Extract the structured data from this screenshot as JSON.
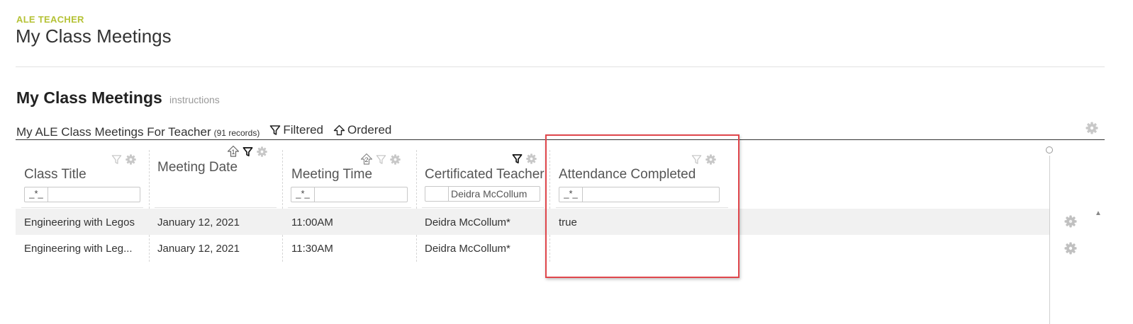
{
  "app": {
    "eyebrow": "ALE TEACHER",
    "title": "My Class Meetings"
  },
  "section": {
    "title": "My Class Meetings",
    "instructions_link": "instructions"
  },
  "view": {
    "name": "My ALE Class Meetings For Teacher",
    "record_count": "(91 records)",
    "filtered_label": "Filtered",
    "ordered_label": "Ordered"
  },
  "columns": [
    {
      "header": "Class Title",
      "filter_tag": "_*_",
      "filter_value": "",
      "sort_order": ""
    },
    {
      "header": "Meeting Date",
      "filter_tag": "",
      "filter_value": "",
      "sort_order": "1"
    },
    {
      "header": "Meeting Time",
      "filter_tag": "_*_",
      "filter_value": "",
      "sort_order": "2"
    },
    {
      "header": "Certificated Teacher",
      "filter_tag": "",
      "filter_value": "Deidra McCollum",
      "sort_order": ""
    },
    {
      "header": "Attendance Completed",
      "filter_tag": "_*_",
      "filter_value": "",
      "sort_order": ""
    }
  ],
  "rows": [
    {
      "class_title": "Engineering with Legos",
      "meeting_date": "January 12, 2021",
      "meeting_time": "11:00AM",
      "teacher": "Deidra McCollum*",
      "attendance_completed": "true"
    },
    {
      "class_title": "Engineering with Leg...",
      "meeting_date": "January 12, 2021",
      "meeting_time": "11:30AM",
      "teacher": "Deidra McCollum*",
      "attendance_completed": ""
    }
  ],
  "scroll_up_glyph": "▲",
  "icons": {
    "gear": "gear-icon",
    "filter": "filter-icon",
    "sort": "sort-order-icon"
  },
  "colors": {
    "eyebrow": "#b5c236",
    "highlight": "#e0474c",
    "alt_row": "#f1f1f1"
  }
}
